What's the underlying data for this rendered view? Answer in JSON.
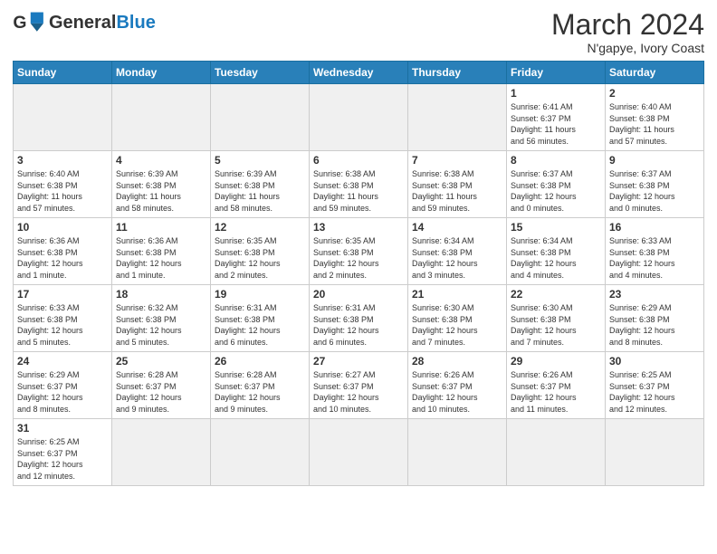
{
  "header": {
    "logo_general": "General",
    "logo_blue": "Blue",
    "month_title": "March 2024",
    "location": "N'gapye, Ivory Coast"
  },
  "weekdays": [
    "Sunday",
    "Monday",
    "Tuesday",
    "Wednesday",
    "Thursday",
    "Friday",
    "Saturday"
  ],
  "weeks": [
    [
      {
        "day": "",
        "info": "",
        "empty": true
      },
      {
        "day": "",
        "info": "",
        "empty": true
      },
      {
        "day": "",
        "info": "",
        "empty": true
      },
      {
        "day": "",
        "info": "",
        "empty": true
      },
      {
        "day": "",
        "info": "",
        "empty": true
      },
      {
        "day": "1",
        "info": "Sunrise: 6:41 AM\nSunset: 6:37 PM\nDaylight: 11 hours\nand 56 minutes."
      },
      {
        "day": "2",
        "info": "Sunrise: 6:40 AM\nSunset: 6:38 PM\nDaylight: 11 hours\nand 57 minutes."
      }
    ],
    [
      {
        "day": "3",
        "info": "Sunrise: 6:40 AM\nSunset: 6:38 PM\nDaylight: 11 hours\nand 57 minutes."
      },
      {
        "day": "4",
        "info": "Sunrise: 6:39 AM\nSunset: 6:38 PM\nDaylight: 11 hours\nand 58 minutes."
      },
      {
        "day": "5",
        "info": "Sunrise: 6:39 AM\nSunset: 6:38 PM\nDaylight: 11 hours\nand 58 minutes."
      },
      {
        "day": "6",
        "info": "Sunrise: 6:38 AM\nSunset: 6:38 PM\nDaylight: 11 hours\nand 59 minutes."
      },
      {
        "day": "7",
        "info": "Sunrise: 6:38 AM\nSunset: 6:38 PM\nDaylight: 11 hours\nand 59 minutes."
      },
      {
        "day": "8",
        "info": "Sunrise: 6:37 AM\nSunset: 6:38 PM\nDaylight: 12 hours\nand 0 minutes."
      },
      {
        "day": "9",
        "info": "Sunrise: 6:37 AM\nSunset: 6:38 PM\nDaylight: 12 hours\nand 0 minutes."
      }
    ],
    [
      {
        "day": "10",
        "info": "Sunrise: 6:36 AM\nSunset: 6:38 PM\nDaylight: 12 hours\nand 1 minute."
      },
      {
        "day": "11",
        "info": "Sunrise: 6:36 AM\nSunset: 6:38 PM\nDaylight: 12 hours\nand 1 minute."
      },
      {
        "day": "12",
        "info": "Sunrise: 6:35 AM\nSunset: 6:38 PM\nDaylight: 12 hours\nand 2 minutes."
      },
      {
        "day": "13",
        "info": "Sunrise: 6:35 AM\nSunset: 6:38 PM\nDaylight: 12 hours\nand 2 minutes."
      },
      {
        "day": "14",
        "info": "Sunrise: 6:34 AM\nSunset: 6:38 PM\nDaylight: 12 hours\nand 3 minutes."
      },
      {
        "day": "15",
        "info": "Sunrise: 6:34 AM\nSunset: 6:38 PM\nDaylight: 12 hours\nand 4 minutes."
      },
      {
        "day": "16",
        "info": "Sunrise: 6:33 AM\nSunset: 6:38 PM\nDaylight: 12 hours\nand 4 minutes."
      }
    ],
    [
      {
        "day": "17",
        "info": "Sunrise: 6:33 AM\nSunset: 6:38 PM\nDaylight: 12 hours\nand 5 minutes."
      },
      {
        "day": "18",
        "info": "Sunrise: 6:32 AM\nSunset: 6:38 PM\nDaylight: 12 hours\nand 5 minutes."
      },
      {
        "day": "19",
        "info": "Sunrise: 6:31 AM\nSunset: 6:38 PM\nDaylight: 12 hours\nand 6 minutes."
      },
      {
        "day": "20",
        "info": "Sunrise: 6:31 AM\nSunset: 6:38 PM\nDaylight: 12 hours\nand 6 minutes."
      },
      {
        "day": "21",
        "info": "Sunrise: 6:30 AM\nSunset: 6:38 PM\nDaylight: 12 hours\nand 7 minutes."
      },
      {
        "day": "22",
        "info": "Sunrise: 6:30 AM\nSunset: 6:38 PM\nDaylight: 12 hours\nand 7 minutes."
      },
      {
        "day": "23",
        "info": "Sunrise: 6:29 AM\nSunset: 6:38 PM\nDaylight: 12 hours\nand 8 minutes."
      }
    ],
    [
      {
        "day": "24",
        "info": "Sunrise: 6:29 AM\nSunset: 6:37 PM\nDaylight: 12 hours\nand 8 minutes."
      },
      {
        "day": "25",
        "info": "Sunrise: 6:28 AM\nSunset: 6:37 PM\nDaylight: 12 hours\nand 9 minutes."
      },
      {
        "day": "26",
        "info": "Sunrise: 6:28 AM\nSunset: 6:37 PM\nDaylight: 12 hours\nand 9 minutes."
      },
      {
        "day": "27",
        "info": "Sunrise: 6:27 AM\nSunset: 6:37 PM\nDaylight: 12 hours\nand 10 minutes."
      },
      {
        "day": "28",
        "info": "Sunrise: 6:26 AM\nSunset: 6:37 PM\nDaylight: 12 hours\nand 10 minutes."
      },
      {
        "day": "29",
        "info": "Sunrise: 6:26 AM\nSunset: 6:37 PM\nDaylight: 12 hours\nand 11 minutes."
      },
      {
        "day": "30",
        "info": "Sunrise: 6:25 AM\nSunset: 6:37 PM\nDaylight: 12 hours\nand 12 minutes."
      }
    ],
    [
      {
        "day": "31",
        "info": "Sunrise: 6:25 AM\nSunset: 6:37 PM\nDaylight: 12 hours\nand 12 minutes."
      },
      {
        "day": "",
        "info": "",
        "empty": true
      },
      {
        "day": "",
        "info": "",
        "empty": true
      },
      {
        "day": "",
        "info": "",
        "empty": true
      },
      {
        "day": "",
        "info": "",
        "empty": true
      },
      {
        "day": "",
        "info": "",
        "empty": true
      },
      {
        "day": "",
        "info": "",
        "empty": true
      }
    ]
  ]
}
